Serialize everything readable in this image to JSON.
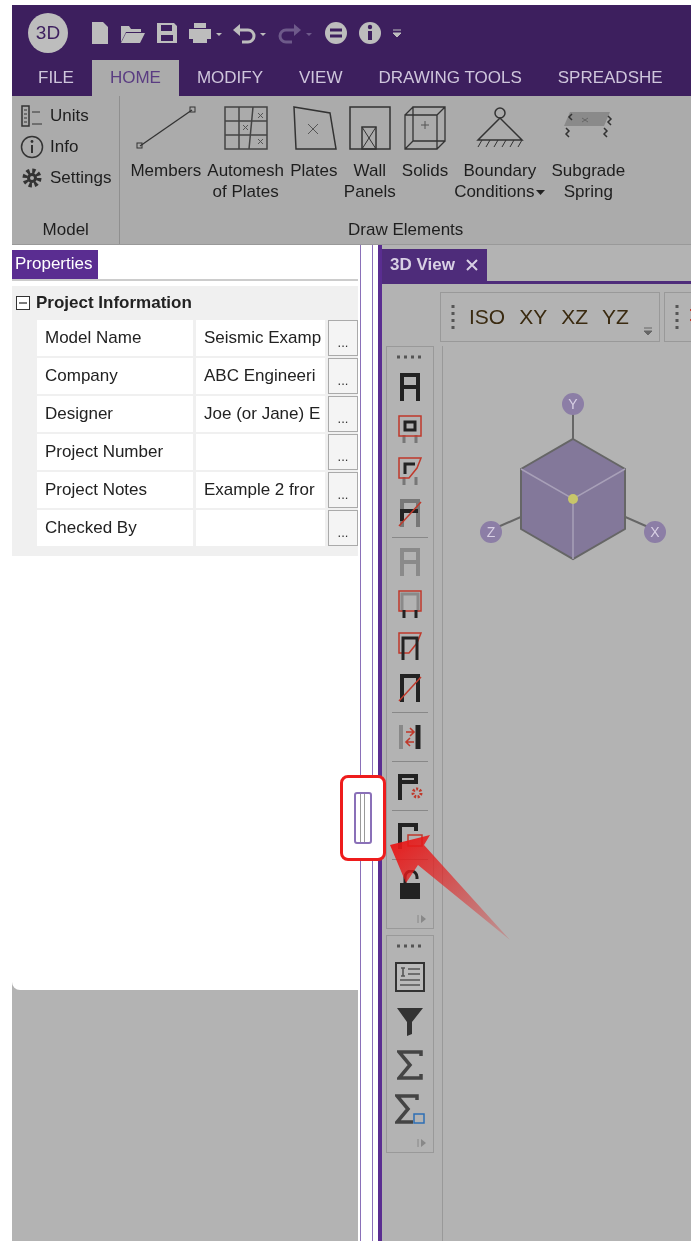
{
  "app_logo": "3D",
  "ribbon_tabs": [
    {
      "label": "FILE",
      "selected": false
    },
    {
      "label": "HOME",
      "selected": true
    },
    {
      "label": "MODIFY",
      "selected": false
    },
    {
      "label": "VIEW",
      "selected": false
    },
    {
      "label": "DRAWING TOOLS",
      "selected": false
    },
    {
      "label": "SPREADSHE",
      "selected": false
    }
  ],
  "ribbon_groups": [
    {
      "name": "Model",
      "kind": "small",
      "items": [
        {
          "lines": [
            "Units"
          ]
        },
        {
          "lines": [
            "Info"
          ]
        },
        {
          "lines": [
            "Settings"
          ]
        }
      ]
    },
    {
      "name": "Draw Elements",
      "kind": "large",
      "items": [
        {
          "lines": [
            "Members"
          ],
          "dropdown": false
        },
        {
          "lines": [
            "Automesh",
            "of Plates"
          ],
          "dropdown": false
        },
        {
          "lines": [
            "Plates"
          ],
          "dropdown": false
        },
        {
          "lines": [
            "Wall",
            "Panels"
          ],
          "dropdown": false
        },
        {
          "lines": [
            "Solids"
          ],
          "dropdown": false
        },
        {
          "lines": [
            "Boundary",
            "Conditions"
          ],
          "dropdown": true
        },
        {
          "lines": [
            "Subgrade",
            "Spring"
          ],
          "dropdown": false
        }
      ]
    }
  ],
  "properties": {
    "title": "Properties",
    "group": {
      "title": "Project Information",
      "expanded": true,
      "rows": [
        {
          "label": "Model Name",
          "value": "Seismic Examp",
          "button": "..."
        },
        {
          "label": "Company",
          "value": "ABC Engineeri",
          "button": "..."
        },
        {
          "label": "Designer",
          "value": "Joe (or Jane) E",
          "button": "..."
        },
        {
          "label": "Project Number",
          "button": "..."
        },
        {
          "label": "Project Notes",
          "value": "Example 2 fror",
          "button": "..."
        },
        {
          "label": "Checked By",
          "button": "..."
        }
      ]
    }
  },
  "document_tab": {
    "title": "3D View",
    "selected": true
  },
  "view_buttons": [
    "ISO",
    "XY",
    "XZ",
    "YZ"
  ],
  "view_cube": {
    "axis_labels": [
      "Y",
      "Z",
      "X"
    ]
  }
}
